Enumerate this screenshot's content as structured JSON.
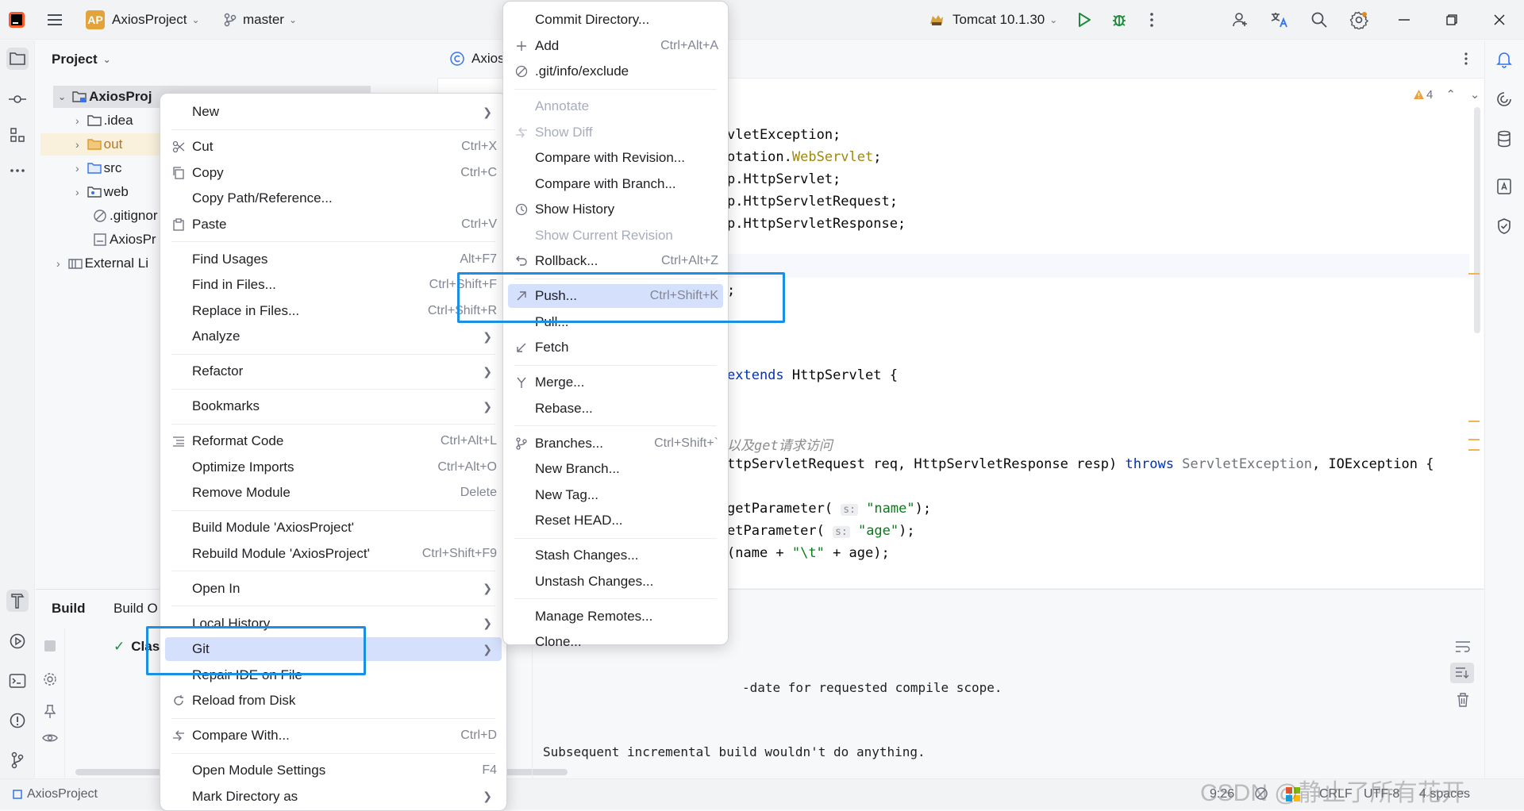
{
  "titlebar": {
    "project_badge": "AP",
    "project_name": "AxiosProject",
    "branch": "master",
    "run_config": "Tomcat 10.1.30"
  },
  "project_panel": {
    "title": "Project",
    "tree": [
      {
        "label": "AxiosProj",
        "type": "module"
      },
      {
        "label": ".idea",
        "type": "folder"
      },
      {
        "label": "out",
        "type": "folder-excluded"
      },
      {
        "label": "src",
        "type": "folder"
      },
      {
        "label": "web",
        "type": "folder"
      },
      {
        "label": ".gitignor",
        "type": "file"
      },
      {
        "label": "AxiosPr",
        "type": "file"
      },
      {
        "label": "External Li",
        "type": "library"
      }
    ]
  },
  "editor": {
    "tab_label": "Axios",
    "warning_count": "4",
    "code_lines": [
      {
        "segments": [
          {
            "t": "vletException;",
            "c": "plain"
          }
        ]
      },
      {
        "segments": [
          {
            "t": "otation.",
            "c": "plain"
          },
          {
            "t": "WebServlet",
            "c": "annot"
          },
          {
            "t": ";",
            "c": "plain"
          }
        ]
      },
      {
        "segments": [
          {
            "t": "p.HttpServlet;",
            "c": "plain"
          }
        ]
      },
      {
        "segments": [
          {
            "t": "p.HttpServletRequest;",
            "c": "plain"
          }
        ]
      },
      {
        "segments": [
          {
            "t": "p.HttpServletResponse;",
            "c": "plain"
          }
        ]
      },
      {
        "segments": [
          {
            "t": "",
            "c": "plain"
          }
        ]
      },
      {
        "segments": [
          {
            "t": ";",
            "c": "plain"
          }
        ]
      },
      {
        "segments": [
          {
            "t": "extends ",
            "c": "kw"
          },
          {
            "t": "HttpServlet {",
            "c": "plain"
          }
        ]
      },
      {
        "segments": [
          {
            "t": "以及get请求访问",
            "c": "comment"
          }
        ]
      },
      {
        "segments": [
          {
            "t": "ttpServletRequest req, HttpServletResponse resp) ",
            "c": "plain"
          },
          {
            "t": "throws ",
            "c": "kw"
          },
          {
            "t": "ServletException",
            "c": "gray"
          },
          {
            "t": ", IOException {",
            "c": "plain"
          }
        ]
      },
      {
        "segments": [
          {
            "t": "getParameter( ",
            "c": "plain"
          },
          {
            "t": "s:",
            "c": "hint"
          },
          {
            "t": " \"name\"",
            "c": "str"
          },
          {
            "t": ");",
            "c": "plain"
          }
        ]
      },
      {
        "segments": [
          {
            "t": "etParameter( ",
            "c": "plain"
          },
          {
            "t": "s:",
            "c": "hint"
          },
          {
            "t": " \"age\"",
            "c": "str"
          },
          {
            "t": ");",
            "c": "plain"
          }
        ]
      },
      {
        "segments": [
          {
            "t": "(name + ",
            "c": "plain"
          },
          {
            "t": "\"\\t\"",
            "c": "str"
          },
          {
            "t": " + age);",
            "c": "plain"
          }
        ]
      }
    ]
  },
  "build_panel": {
    "tabs": [
      "Build",
      "Build O"
    ],
    "tree_item": "Clas",
    "output_lines": [
      "-date for requested compile scope.",
      "Subsequent incremental build wouldn't do anything."
    ]
  },
  "statusbar": {
    "breadcrumb": "AxiosProject",
    "position": "9:26",
    "line_sep": "CRLF",
    "encoding": "UTF-8",
    "indent": "4 spaces",
    "watermark": "CSDN @静止了所有花开"
  },
  "context_menu": {
    "items": [
      {
        "label": "New",
        "shortcut": "",
        "submenu": true
      },
      {
        "sep": true
      },
      {
        "label": "Cut",
        "shortcut": "Ctrl+X",
        "icon": "scissors"
      },
      {
        "label": "Copy",
        "shortcut": "Ctrl+C",
        "icon": "copy"
      },
      {
        "label": "Copy Path/Reference...",
        "shortcut": ""
      },
      {
        "label": "Paste",
        "shortcut": "Ctrl+V",
        "icon": "paste"
      },
      {
        "sep": true
      },
      {
        "label": "Find Usages",
        "shortcut": "Alt+F7"
      },
      {
        "label": "Find in Files...",
        "shortcut": "Ctrl+Shift+F"
      },
      {
        "label": "Replace in Files...",
        "shortcut": "Ctrl+Shift+R"
      },
      {
        "label": "Analyze",
        "shortcut": "",
        "submenu": true
      },
      {
        "sep": true
      },
      {
        "label": "Refactor",
        "shortcut": "",
        "submenu": true
      },
      {
        "sep": true
      },
      {
        "label": "Bookmarks",
        "shortcut": "",
        "submenu": true
      },
      {
        "sep": true
      },
      {
        "label": "Reformat Code",
        "shortcut": "Ctrl+Alt+L",
        "icon": "reformat"
      },
      {
        "label": "Optimize Imports",
        "shortcut": "Ctrl+Alt+O"
      },
      {
        "label": "Remove Module",
        "shortcut": "Delete"
      },
      {
        "sep": true
      },
      {
        "label": "Build Module 'AxiosProject'",
        "shortcut": ""
      },
      {
        "label": "Rebuild Module 'AxiosProject'",
        "shortcut": "Ctrl+Shift+F9"
      },
      {
        "sep": true
      },
      {
        "label": "Open In",
        "shortcut": "",
        "submenu": true
      },
      {
        "sep": true
      },
      {
        "label": "Local History",
        "shortcut": "",
        "submenu": true
      },
      {
        "label": "Git",
        "shortcut": "",
        "submenu": true,
        "selected": true
      },
      {
        "label": "Repair IDE on File",
        "shortcut": ""
      },
      {
        "label": "Reload from Disk",
        "shortcut": "",
        "icon": "reload"
      },
      {
        "sep": true
      },
      {
        "label": "Compare With...",
        "shortcut": "Ctrl+D",
        "icon": "compare"
      },
      {
        "sep": true
      },
      {
        "label": "Open Module Settings",
        "shortcut": "F4"
      },
      {
        "label": "Mark Directory as",
        "shortcut": "",
        "submenu": true
      }
    ]
  },
  "git_menu": {
    "items": [
      {
        "label": "Commit Directory...",
        "shortcut": ""
      },
      {
        "label": "Add",
        "shortcut": "Ctrl+Alt+A",
        "icon": "plus"
      },
      {
        "label": ".git/info/exclude",
        "shortcut": "",
        "icon": "ignore"
      },
      {
        "sep": true
      },
      {
        "label": "Annotate",
        "shortcut": "",
        "disabled": true
      },
      {
        "label": "Show Diff",
        "shortcut": "",
        "disabled": true,
        "icon": "diff"
      },
      {
        "label": "Compare with Revision...",
        "shortcut": ""
      },
      {
        "label": "Compare with Branch...",
        "shortcut": ""
      },
      {
        "label": "Show History",
        "shortcut": "",
        "icon": "history"
      },
      {
        "label": "Show Current Revision",
        "shortcut": "",
        "disabled": true
      },
      {
        "label": "Rollback...",
        "shortcut": "Ctrl+Alt+Z",
        "icon": "rollback"
      },
      {
        "sep": true
      },
      {
        "label": "Push...",
        "shortcut": "Ctrl+Shift+K",
        "icon": "push",
        "selected": true
      },
      {
        "label": "Pull...",
        "shortcut": ""
      },
      {
        "label": "Fetch",
        "shortcut": "",
        "icon": "fetch"
      },
      {
        "sep": true
      },
      {
        "label": "Merge...",
        "shortcut": "",
        "icon": "merge"
      },
      {
        "label": "Rebase...",
        "shortcut": ""
      },
      {
        "sep": true
      },
      {
        "label": "Branches...",
        "shortcut": "Ctrl+Shift+`",
        "icon": "branch"
      },
      {
        "label": "New Branch...",
        "shortcut": ""
      },
      {
        "label": "New Tag...",
        "shortcut": ""
      },
      {
        "label": "Reset HEAD...",
        "shortcut": ""
      },
      {
        "sep": true
      },
      {
        "label": "Stash Changes...",
        "shortcut": ""
      },
      {
        "label": "Unstash Changes...",
        "shortcut": ""
      },
      {
        "sep": true
      },
      {
        "label": "Manage Remotes...",
        "shortcut": ""
      },
      {
        "label": "Clone...",
        "shortcut": ""
      }
    ]
  },
  "colors": {
    "highlight_box": "#1a8fe3",
    "selection": "#d5e1fc",
    "keyword": "#0033b3",
    "string": "#067d17",
    "annotation": "#9e880d",
    "comment": "#8c8c8c"
  }
}
